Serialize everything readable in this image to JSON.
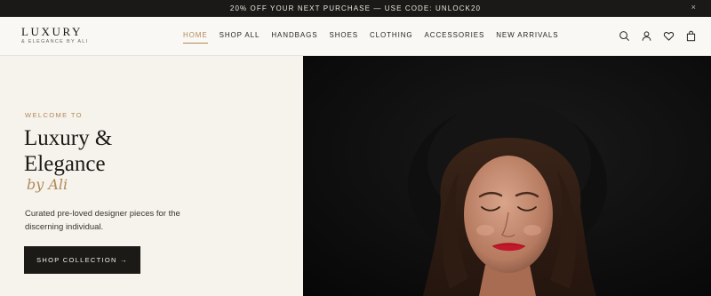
{
  "announcement": {
    "text": "20% OFF YOUR NEXT PURCHASE — USE CODE: UNLOCK20",
    "close": "×"
  },
  "brand": {
    "name": "LUXURY",
    "tagline": "& ELEGANCE BY ALI"
  },
  "nav": {
    "items": [
      "HOME",
      "SHOP ALL",
      "HANDBAGS",
      "SHOES",
      "CLOTHING",
      "ACCESSORIES",
      "NEW ARRIVALS"
    ],
    "active": "HOME"
  },
  "header_icons": [
    "search-icon",
    "account-icon",
    "wishlist-heart-icon",
    "cart-bag-icon"
  ],
  "hero": {
    "eyebrow": "WELCOME TO",
    "headline_line1": "Luxury &",
    "headline_line2": "Elegance",
    "script": "by Ali",
    "description": "Curated pre-loved designer pieces for the discerning individual.",
    "cta": "SHOP COLLECTION →",
    "image": "portrait-woman-black-hat-red-lips"
  },
  "colors": {
    "accent": "#b08a58",
    "dark": "#1b1917",
    "background": "#f6f2ec"
  }
}
